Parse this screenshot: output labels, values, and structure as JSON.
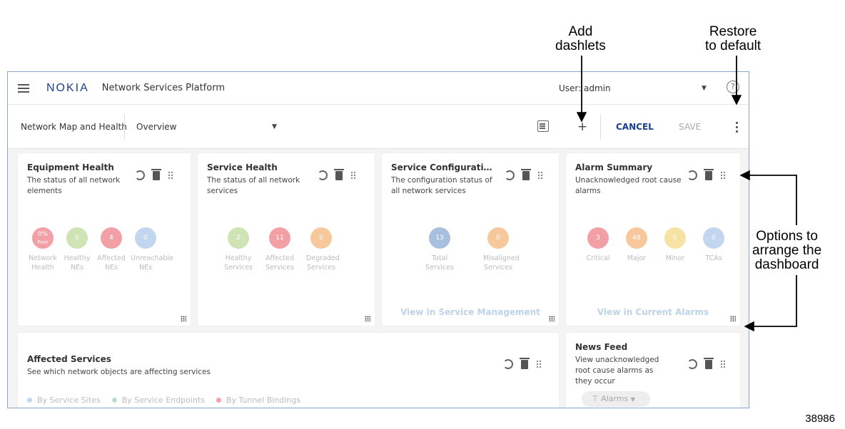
{
  "callouts": {
    "add_dashlets": "Add\ndashlets",
    "restore_default": "Restore\nto default",
    "options_arrange": "Options to\narrange the\ndashboard"
  },
  "figure_number": "38986",
  "header": {
    "logo": "NOKIA",
    "app_title": "Network Services Platform",
    "user": "User: admin"
  },
  "toolbar": {
    "breadcrumb": "Network Map and Health",
    "view": "Overview",
    "add_symbol": "+",
    "cancel": "CANCEL",
    "save": "SAVE"
  },
  "dashlets": {
    "equipment_health": {
      "title": "Equipment Health",
      "description": "The status of all network elements",
      "metrics": [
        {
          "value": "0%",
          "sub": "Poor",
          "label": "Network\nHealth",
          "color": "#f2a0a6"
        },
        {
          "value": "0",
          "sub": "",
          "label": "Healthy\nNEs",
          "color": "#cfe3b4"
        },
        {
          "value": "4",
          "sub": "",
          "label": "Affected\nNEs",
          "color": "#f2a0a6"
        },
        {
          "value": "0",
          "sub": "",
          "label": "Unreachable\nNEs",
          "color": "#c2d6ef"
        }
      ]
    },
    "service_health": {
      "title": "Service Health",
      "description": "The status of all network services",
      "metrics": [
        {
          "value": "2",
          "label": "Healthy\nServices",
          "color": "#cfe3b4"
        },
        {
          "value": "11",
          "label": "Affected\nServices",
          "color": "#f2a0a6"
        },
        {
          "value": "0",
          "label": "Degraded\nServices",
          "color": "#f6c89c"
        }
      ]
    },
    "service_configuration": {
      "title": "Service Configurati…",
      "description": "The configuration status of all network services",
      "metrics": [
        {
          "value": "13",
          "label": "Total\nServices",
          "color": "#a9bfde"
        },
        {
          "value": "0",
          "label": "Misaligned\nServices",
          "color": "#f6c89c"
        }
      ],
      "link": "View in Service Management"
    },
    "alarm_summary": {
      "title": "Alarm Summary",
      "description": "Unacknowledged root cause alarms",
      "metrics": [
        {
          "value": "3",
          "label": "Critical",
          "color": "#f2a0a6"
        },
        {
          "value": "48",
          "label": "Major",
          "color": "#f6c89c"
        },
        {
          "value": "0",
          "label": "Minor",
          "color": "#f7e2a3"
        },
        {
          "value": "0",
          "label": "TCAs",
          "color": "#c2d6ef"
        }
      ],
      "link": "View in Current Alarms"
    },
    "affected_services": {
      "title": "Affected Services",
      "description": "See which network objects are affecting services",
      "legend": [
        {
          "label": "By Service Sites",
          "color": "#c2d6ef"
        },
        {
          "label": "By Service Endpoints",
          "color": "#b8dcc8"
        },
        {
          "label": "By Tunnel Bindings",
          "color": "#f2a0a6"
        }
      ]
    },
    "news_feed": {
      "title": "News Feed",
      "description": "View unacknowledged root cause alarms as they occur",
      "filter": "Alarms"
    }
  }
}
